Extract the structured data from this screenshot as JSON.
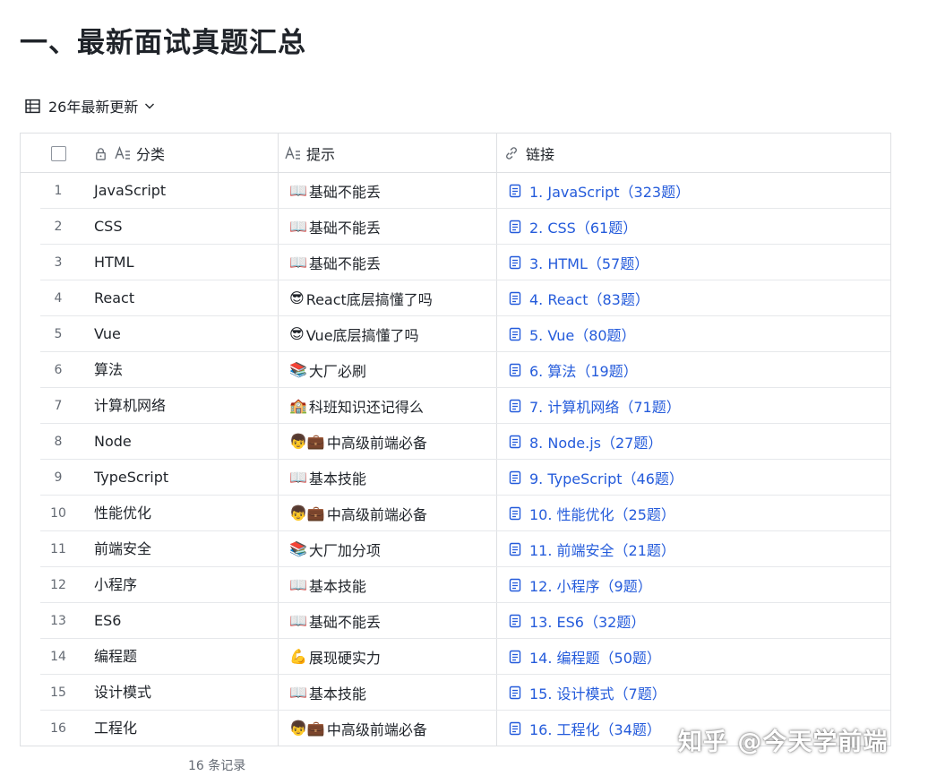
{
  "page": {
    "title": "一、最新面试真题汇总",
    "view_name": "26年最新更新"
  },
  "table": {
    "columns": [
      {
        "label": "分类",
        "icon": "text-field-icon"
      },
      {
        "label": "提示",
        "icon": "text-field-icon"
      },
      {
        "label": "链接",
        "icon": "link-icon"
      }
    ],
    "rows": [
      {
        "num": "1",
        "category": "JavaScript",
        "hint_emoji": "📖",
        "hint": "基础不能丢",
        "link": "1. JavaScript（323题）"
      },
      {
        "num": "2",
        "category": "CSS",
        "hint_emoji": "📖",
        "hint": "基础不能丢",
        "link": "2. CSS（61题）"
      },
      {
        "num": "3",
        "category": "HTML",
        "hint_emoji": "📖",
        "hint": "基础不能丢",
        "link": "3. HTML（57题）"
      },
      {
        "num": "4",
        "category": "React",
        "hint_emoji": "😎",
        "hint": "React底层搞懂了吗",
        "link": "4. React（83题）"
      },
      {
        "num": "5",
        "category": "Vue",
        "hint_emoji": "😎",
        "hint": "Vue底层搞懂了吗",
        "link": "5. Vue（80题）"
      },
      {
        "num": "6",
        "category": "算法",
        "hint_emoji": "📚",
        "hint": "大厂必刷",
        "link": "6. 算法（19题）"
      },
      {
        "num": "7",
        "category": "计算机网络",
        "hint_emoji": "🏫",
        "hint": "科班知识还记得么",
        "link": "7. 计算机网络（71题）"
      },
      {
        "num": "8",
        "category": "Node",
        "hint_emoji": "👦💼",
        "hint": "中高级前端必备",
        "link": "8. Node.js（27题）"
      },
      {
        "num": "9",
        "category": "TypeScript",
        "hint_emoji": "📖",
        "hint": "基本技能",
        "link": "9. TypeScript（46题）"
      },
      {
        "num": "10",
        "category": "性能优化",
        "hint_emoji": "👦💼",
        "hint": "中高级前端必备",
        "link": "10. 性能优化（25题）"
      },
      {
        "num": "11",
        "category": "前端安全",
        "hint_emoji": "📚",
        "hint": "大厂加分项",
        "link": "11. 前端安全（21题）"
      },
      {
        "num": "12",
        "category": "小程序",
        "hint_emoji": "📖",
        "hint": "基本技能",
        "link": "12. 小程序（9题）"
      },
      {
        "num": "13",
        "category": "ES6",
        "hint_emoji": "📖",
        "hint": "基础不能丢",
        "link": "13. ES6（32题）"
      },
      {
        "num": "14",
        "category": "编程题",
        "hint_emoji": "💪",
        "hint": "展现硬实力",
        "link": "14. 编程题（50题）"
      },
      {
        "num": "15",
        "category": "设计模式",
        "hint_emoji": "📖",
        "hint": "基本技能",
        "link": "15. 设计模式（7题）"
      },
      {
        "num": "16",
        "category": "工程化",
        "hint_emoji": "👦💼",
        "hint": "中高级前端必备",
        "link": "16. 工程化（34题）"
      }
    ],
    "footer_count": "16 条记录"
  },
  "watermark": {
    "brand": "知乎 @今天学前端"
  },
  "colors": {
    "link": "#245bdb",
    "border": "#dee0e3",
    "text": "#1f2329",
    "muted": "#646a73"
  }
}
